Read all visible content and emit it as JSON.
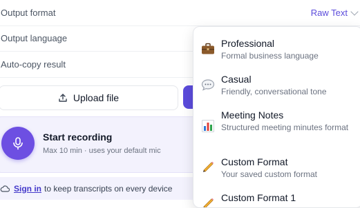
{
  "settings": {
    "output_format_label": "Output format",
    "output_format_value": "Raw Text",
    "output_language_label": "Output language",
    "auto_copy_label": "Auto-copy result"
  },
  "actions": {
    "upload_label": "Upload file"
  },
  "recording": {
    "title": "Start recording",
    "subtitle": "Max 10 min · uses your default mic"
  },
  "signin": {
    "link": "Sign in",
    "text": "to keep transcripts on every device"
  },
  "format_options": [
    {
      "name": "Professional",
      "description": "Formal business language",
      "icon": "briefcase-icon"
    },
    {
      "name": "Casual",
      "description": "Friendly, conversational tone",
      "icon": "speech-bubble-icon"
    },
    {
      "name": "Meeting Notes",
      "description": "Structured meeting minutes format",
      "icon": "bar-chart-icon"
    },
    {
      "name": "Custom Format",
      "description": "Your saved custom format",
      "icon": "pencil-icon"
    },
    {
      "name": "Custom Format 1",
      "description": "",
      "icon": "pencil-icon"
    }
  ],
  "colors": {
    "accent": "#5b4bdb",
    "mic": "#6d4fe2",
    "card_bg": "#f3f2fd"
  }
}
